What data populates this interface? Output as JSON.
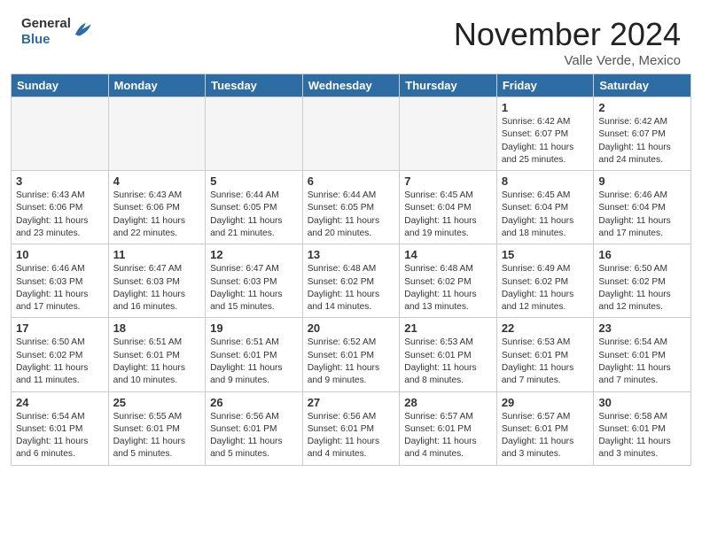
{
  "header": {
    "logo_general": "General",
    "logo_blue": "Blue",
    "month": "November 2024",
    "location": "Valle Verde, Mexico"
  },
  "weekdays": [
    "Sunday",
    "Monday",
    "Tuesday",
    "Wednesday",
    "Thursday",
    "Friday",
    "Saturday"
  ],
  "weeks": [
    [
      {
        "day": "",
        "content": ""
      },
      {
        "day": "",
        "content": ""
      },
      {
        "day": "",
        "content": ""
      },
      {
        "day": "",
        "content": ""
      },
      {
        "day": "",
        "content": ""
      },
      {
        "day": "1",
        "content": "Sunrise: 6:42 AM\nSunset: 6:07 PM\nDaylight: 11 hours\nand 25 minutes."
      },
      {
        "day": "2",
        "content": "Sunrise: 6:42 AM\nSunset: 6:07 PM\nDaylight: 11 hours\nand 24 minutes."
      }
    ],
    [
      {
        "day": "3",
        "content": "Sunrise: 6:43 AM\nSunset: 6:06 PM\nDaylight: 11 hours\nand 23 minutes."
      },
      {
        "day": "4",
        "content": "Sunrise: 6:43 AM\nSunset: 6:06 PM\nDaylight: 11 hours\nand 22 minutes."
      },
      {
        "day": "5",
        "content": "Sunrise: 6:44 AM\nSunset: 6:05 PM\nDaylight: 11 hours\nand 21 minutes."
      },
      {
        "day": "6",
        "content": "Sunrise: 6:44 AM\nSunset: 6:05 PM\nDaylight: 11 hours\nand 20 minutes."
      },
      {
        "day": "7",
        "content": "Sunrise: 6:45 AM\nSunset: 6:04 PM\nDaylight: 11 hours\nand 19 minutes."
      },
      {
        "day": "8",
        "content": "Sunrise: 6:45 AM\nSunset: 6:04 PM\nDaylight: 11 hours\nand 18 minutes."
      },
      {
        "day": "9",
        "content": "Sunrise: 6:46 AM\nSunset: 6:04 PM\nDaylight: 11 hours\nand 17 minutes."
      }
    ],
    [
      {
        "day": "10",
        "content": "Sunrise: 6:46 AM\nSunset: 6:03 PM\nDaylight: 11 hours\nand 17 minutes."
      },
      {
        "day": "11",
        "content": "Sunrise: 6:47 AM\nSunset: 6:03 PM\nDaylight: 11 hours\nand 16 minutes."
      },
      {
        "day": "12",
        "content": "Sunrise: 6:47 AM\nSunset: 6:03 PM\nDaylight: 11 hours\nand 15 minutes."
      },
      {
        "day": "13",
        "content": "Sunrise: 6:48 AM\nSunset: 6:02 PM\nDaylight: 11 hours\nand 14 minutes."
      },
      {
        "day": "14",
        "content": "Sunrise: 6:48 AM\nSunset: 6:02 PM\nDaylight: 11 hours\nand 13 minutes."
      },
      {
        "day": "15",
        "content": "Sunrise: 6:49 AM\nSunset: 6:02 PM\nDaylight: 11 hours\nand 12 minutes."
      },
      {
        "day": "16",
        "content": "Sunrise: 6:50 AM\nSunset: 6:02 PM\nDaylight: 11 hours\nand 12 minutes."
      }
    ],
    [
      {
        "day": "17",
        "content": "Sunrise: 6:50 AM\nSunset: 6:02 PM\nDaylight: 11 hours\nand 11 minutes."
      },
      {
        "day": "18",
        "content": "Sunrise: 6:51 AM\nSunset: 6:01 PM\nDaylight: 11 hours\nand 10 minutes."
      },
      {
        "day": "19",
        "content": "Sunrise: 6:51 AM\nSunset: 6:01 PM\nDaylight: 11 hours\nand 9 minutes."
      },
      {
        "day": "20",
        "content": "Sunrise: 6:52 AM\nSunset: 6:01 PM\nDaylight: 11 hours\nand 9 minutes."
      },
      {
        "day": "21",
        "content": "Sunrise: 6:53 AM\nSunset: 6:01 PM\nDaylight: 11 hours\nand 8 minutes."
      },
      {
        "day": "22",
        "content": "Sunrise: 6:53 AM\nSunset: 6:01 PM\nDaylight: 11 hours\nand 7 minutes."
      },
      {
        "day": "23",
        "content": "Sunrise: 6:54 AM\nSunset: 6:01 PM\nDaylight: 11 hours\nand 7 minutes."
      }
    ],
    [
      {
        "day": "24",
        "content": "Sunrise: 6:54 AM\nSunset: 6:01 PM\nDaylight: 11 hours\nand 6 minutes."
      },
      {
        "day": "25",
        "content": "Sunrise: 6:55 AM\nSunset: 6:01 PM\nDaylight: 11 hours\nand 5 minutes."
      },
      {
        "day": "26",
        "content": "Sunrise: 6:56 AM\nSunset: 6:01 PM\nDaylight: 11 hours\nand 5 minutes."
      },
      {
        "day": "27",
        "content": "Sunrise: 6:56 AM\nSunset: 6:01 PM\nDaylight: 11 hours\nand 4 minutes."
      },
      {
        "day": "28",
        "content": "Sunrise: 6:57 AM\nSunset: 6:01 PM\nDaylight: 11 hours\nand 4 minutes."
      },
      {
        "day": "29",
        "content": "Sunrise: 6:57 AM\nSunset: 6:01 PM\nDaylight: 11 hours\nand 3 minutes."
      },
      {
        "day": "30",
        "content": "Sunrise: 6:58 AM\nSunset: 6:01 PM\nDaylight: 11 hours\nand 3 minutes."
      }
    ]
  ]
}
